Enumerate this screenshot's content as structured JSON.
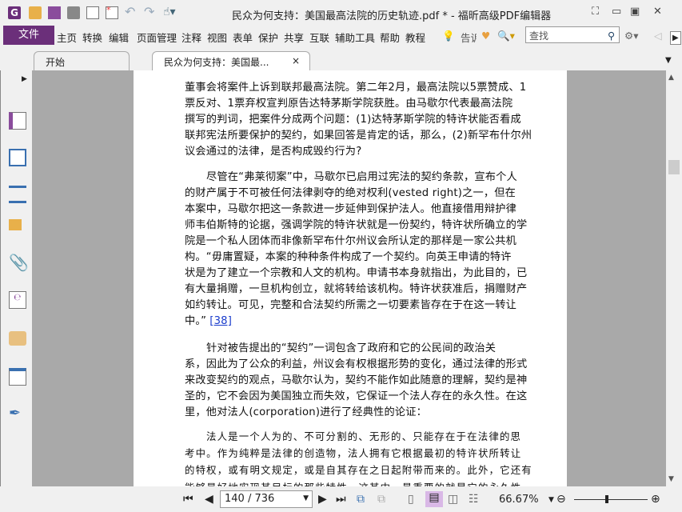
{
  "window": {
    "title": "民众为何支持：美国最高法院的历史轨迹.pdf * - 福昕高级PDF编辑器"
  },
  "menu": {
    "file": "文件",
    "items": [
      "主页",
      "转换",
      "编辑",
      "页面管理",
      "注释",
      "视图",
      "表单",
      "保护",
      "共享",
      "互联",
      "辅助工具",
      "帮助",
      "教程"
    ],
    "tell_me": "告诉",
    "search_placeholder": "查找"
  },
  "tabs": [
    {
      "label": "开始"
    },
    {
      "label": "民众为何支持：美国最...",
      "close": "×"
    }
  ],
  "sidebar": {
    "icons": [
      "bookmark-icon",
      "pages-icon",
      "layers-icon",
      "comments-icon",
      "attachments-icon",
      "signature-icon",
      "security-icon",
      "form-fields-icon",
      "certify-icon"
    ]
  },
  "document": {
    "paragraphs": [
      {
        "indent": false,
        "lines": [
          "董事会将案件上诉到联邦最高法院。第二年2月，最高法院以5票赞成、1",
          "票反对、1票弃权宣判原告达特茅斯学院获胜。由马歇尔代表最高法院",
          "撰写的判词，把案件分成两个问题：(1)达特茅斯学院的特许状能否看成",
          "联邦宪法所要保护的契约，如果回答是肯定的话，那么，(2)新罕布什尔州",
          "议会通过的法律，是否构成毁约行为?"
        ]
      },
      {
        "indent": true,
        "lines": [
          "尽管在“弗莱彻案”中，马歇尔已启用过宪法的契约条款，宣布个人",
          "的财产属于不可被任何法律剥夺的绝对权利(vested right)之一，但在",
          "本案中，马歇尔把这一条款进一步延伸到保护法人。他直接借用辩护律",
          "师韦伯斯特的论据，强调学院的特许状就是一份契约，特许状所确立的学",
          "院是一个私人团体而非像新罕布什尔州议会所认定的那样是一家公共机",
          "构。“毋庸置疑，本案的种种条件构成了一个契约。向英王申请的特许",
          "状是为了建立一个宗教和人文的机构。申请书本身就指出，为此目的，已",
          "有大量捐赠，一旦机构创立，就将转给该机构。特许状获准后，捐赠财产",
          "如约转让。可见，完整和合法契约所需之一切要素皆存在于在这一转让",
          "中。”"
        ],
        "ref": "[38]"
      },
      {
        "indent": true,
        "lines": [
          "针对被告提出的“契约”一词包含了政府和它的公民间的政治关",
          "系，因此为了公众的利益，州议会有权根据形势的变化，通过法律的形式",
          "来改变契约的观点，马歇尔认为，契约不能作如此随意的理解，契约是神",
          "圣的，它不会因为美国独立而失效，它保证一个法人存在的永久性。在这",
          "里，他对法人(corporation)进行了经典性的论证："
        ]
      },
      {
        "indent": true,
        "quote": true,
        "lines": [
          "法人是一个人为的、不可分割的、无形的、只能存在于在法律的思",
          "考中。作为纯粹是法律的创造物，法人拥有它根据最初的特许状所转让",
          "的特权，或有明文规定，或是自其存在之日起附带而来的。此外，它还有",
          "能够最好地实现其目标的那些特性。这其中，最重要的就是它的永久性，"
        ]
      }
    ]
  },
  "statusbar": {
    "page": "140 / 736",
    "zoom": "66.67%",
    "zoom_level_percent": 66.67
  },
  "colors": {
    "accent": "#6b2f7a",
    "link": "#1a3ccc",
    "canvas": "#a9a9a9"
  }
}
